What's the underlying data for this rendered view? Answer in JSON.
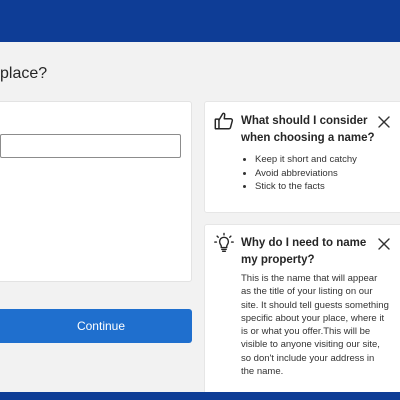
{
  "page": {
    "title": "place?"
  },
  "form": {
    "name_value": "",
    "continue_label": "Continue"
  },
  "tips": [
    {
      "icon": "thumbs-up-icon",
      "title": "What should I consider when choosing a name?",
      "items": [
        "Keep it short and catchy",
        "Avoid abbreviations",
        "Stick to the facts"
      ]
    },
    {
      "icon": "lightbulb-icon",
      "title": "Why do I need to name my property?",
      "body": "This is the name that will appear as the title of your listing on our site. It should tell guests something specific about your place, where it is or what you offer.This will be visible to anyone visiting our site, so don't include your address in the name."
    }
  ],
  "colors": {
    "header_bg": "#0e3d96",
    "button_bg": "#1f6fce",
    "page_bg": "#f2f2f2"
  }
}
